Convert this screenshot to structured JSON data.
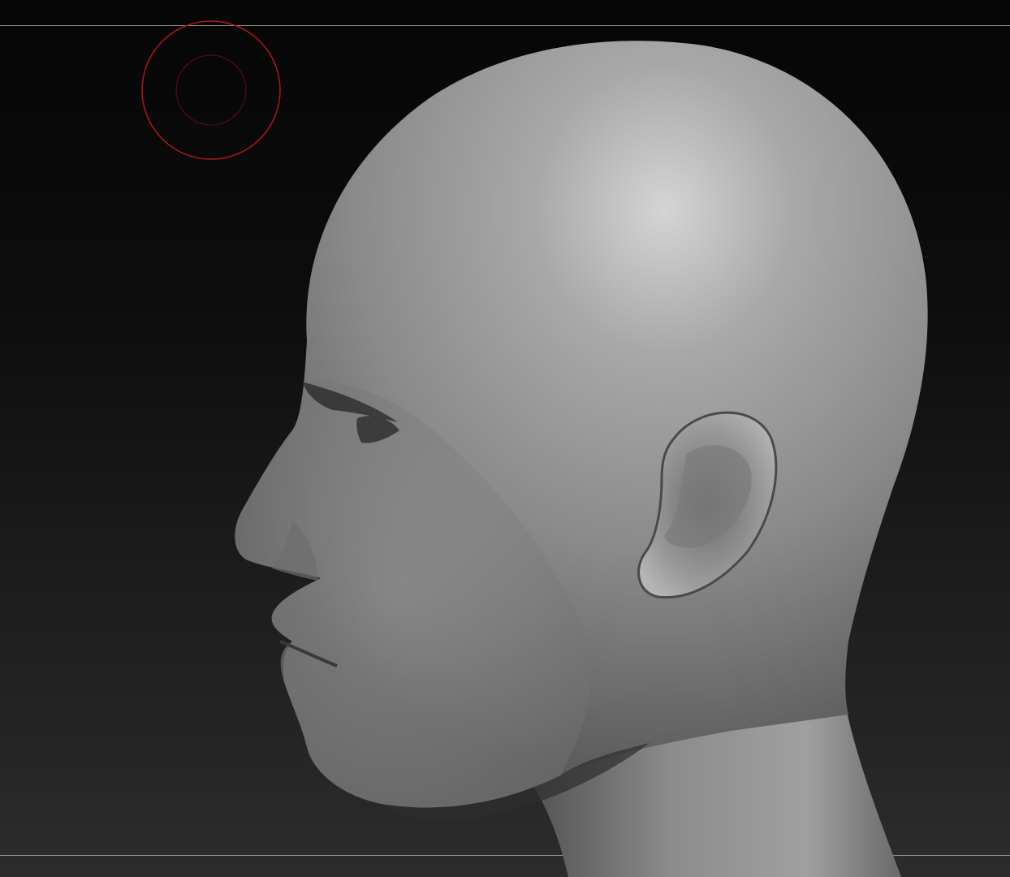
{
  "viewport": {
    "background_top": "#060606",
    "background_bottom": "#2c2c2c"
  },
  "brush": {
    "outer_ring_color": "#b0141c",
    "inner_ring_color": "#5a0a10"
  },
  "model": {
    "material_color": "#8f8f8f",
    "highlight_color": "#d2d2d2",
    "shadow_color": "#3a3a3a"
  }
}
